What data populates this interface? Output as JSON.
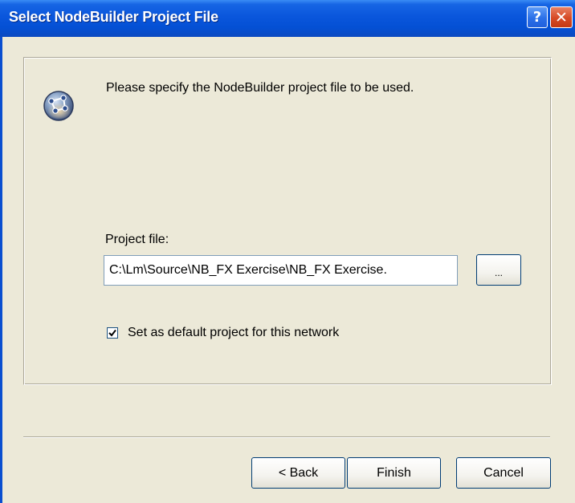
{
  "window": {
    "title": "Select NodeBuilder Project File",
    "help_glyph": "?",
    "close_glyph": "✕"
  },
  "icons": {
    "app": "nodebuilder-globe-icon",
    "help": "help-icon",
    "close": "close-icon",
    "check": "check-icon"
  },
  "body": {
    "instruction": "Please specify the NodeBuilder project file to be used.",
    "project_file_label": "Project file:",
    "project_file_value": "C:\\Lm\\Source\\NB_FX Exercise\\NB_FX Exercise.",
    "browse_label": "...",
    "default_checkbox": {
      "checked": true,
      "label": "Set as default project for this network"
    }
  },
  "footer": {
    "back_label": "< Back",
    "finish_label": "Finish",
    "cancel_label": "Cancel"
  },
  "colors": {
    "titlebar": "#0a56dc",
    "dialog_bg": "#ece9d8",
    "close_button": "#d64a25"
  }
}
